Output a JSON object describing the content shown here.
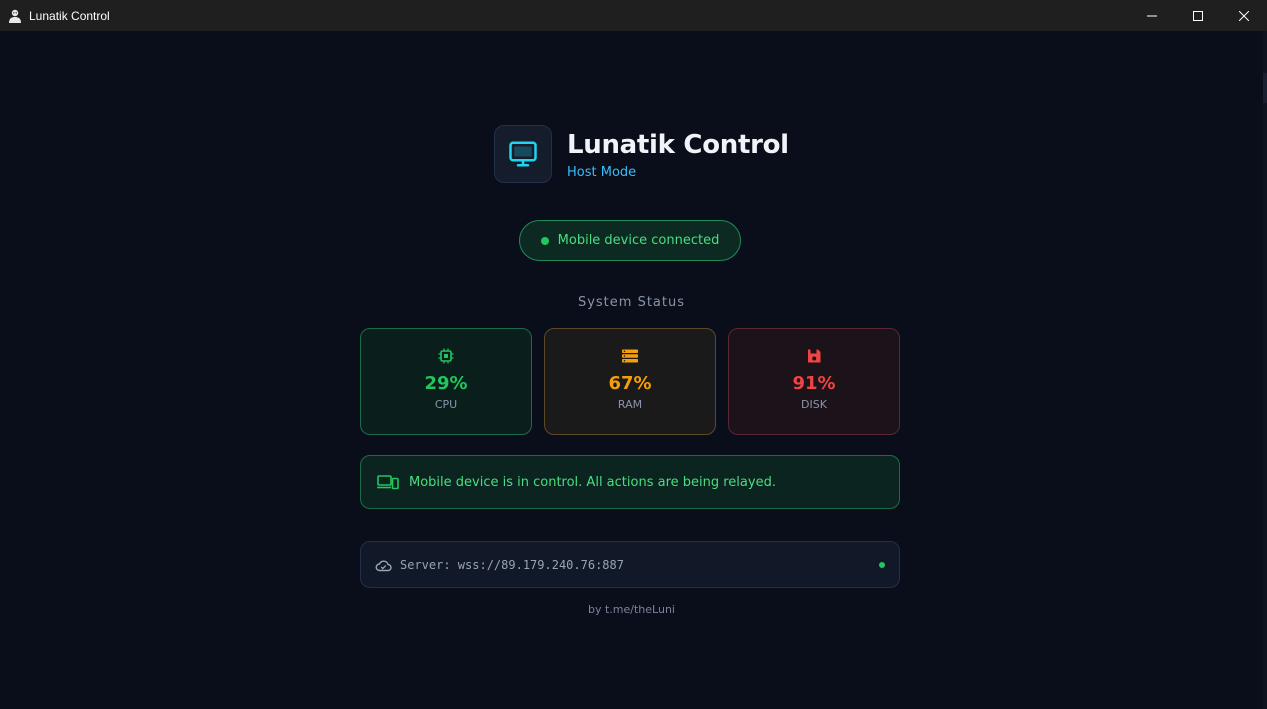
{
  "window": {
    "title": "Lunatik Control"
  },
  "header": {
    "title": "Lunatik Control",
    "subtitle": "Host Mode"
  },
  "connection": {
    "status_text": "Mobile device connected"
  },
  "system_status": {
    "title": "System Status",
    "cards": [
      {
        "label": "CPU",
        "value": "29%",
        "icon": "chip-icon",
        "color": "#22c55e"
      },
      {
        "label": "RAM",
        "value": "67%",
        "icon": "memory-icon",
        "color": "#f59e0b"
      },
      {
        "label": "DISK",
        "value": "91%",
        "icon": "save-disk-icon",
        "color": "#ef4444"
      }
    ]
  },
  "banner": {
    "text": "Mobile device is in control. All actions are being relayed.",
    "icon": "devices-icon"
  },
  "server": {
    "text": "Server: wss://89.179.240.76:887",
    "icon": "cloud-icon",
    "status_color": "#22c55e"
  },
  "footer": {
    "text": "by t.me/theLuni"
  },
  "colors": {
    "background": "#0a0e1a",
    "accent": "#38bdf8",
    "success": "#4ade80"
  }
}
